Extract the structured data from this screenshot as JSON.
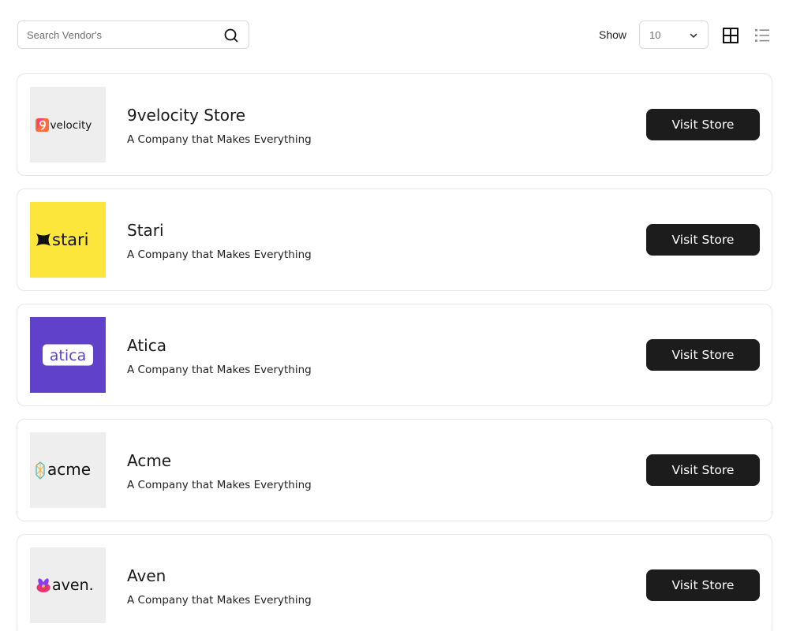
{
  "search": {
    "placeholder": "Search Vendor's",
    "value": ""
  },
  "pagination": {
    "show_label": "Show",
    "page_size": "10"
  },
  "vendors": [
    {
      "name": "9velocity Store",
      "description": "A Company that Makes Everything",
      "logo_text": "velocity",
      "logo_bg": "#eeeeee",
      "button_label": "Visit Store"
    },
    {
      "name": "Stari",
      "description": "A Company that Makes Everything",
      "logo_text": "stari",
      "logo_bg": "#fde63b",
      "button_label": "Visit Store"
    },
    {
      "name": "Atica",
      "description": "A Company that Makes Everything",
      "logo_text": "atica",
      "logo_bg": "#5f42c9",
      "button_label": "Visit Store"
    },
    {
      "name": "Acme",
      "description": "A Company that Makes Everything",
      "logo_text": "acme",
      "logo_bg": "#eeeeee",
      "button_label": "Visit Store"
    },
    {
      "name": "Aven",
      "description": "A Company that Makes Everything",
      "logo_text": "aven.",
      "logo_bg": "#eeeeee",
      "button_label": "Visit Store"
    }
  ],
  "colors": {
    "button_bg": "#1c1c1c",
    "card_border": "#e6e6e6",
    "stari_yellow": "#fde63b",
    "atica_purple": "#5f42c9"
  },
  "icons": {
    "search": "search-icon",
    "dropdown": "chevron-down-icon",
    "grid_view": "grid-view-icon",
    "list_view": "list-view-icon"
  }
}
